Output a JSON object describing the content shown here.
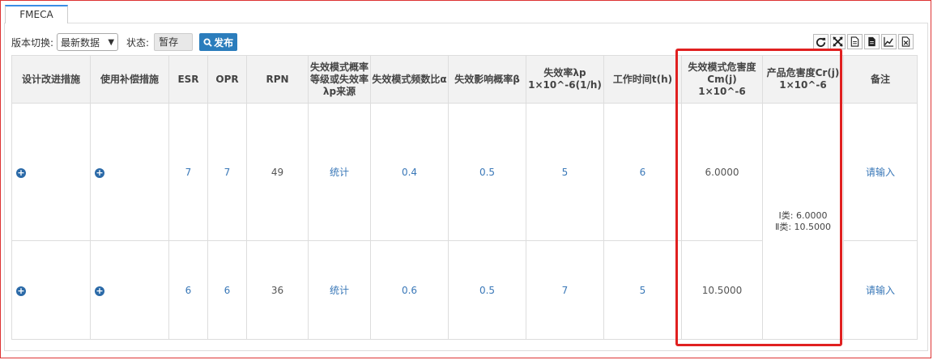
{
  "tab": {
    "label": "FMECA"
  },
  "toolbar": {
    "version_label": "版本切换:",
    "version_value": "最新数据",
    "status_label": "状态:",
    "status_value": "暂存",
    "publish_label": "发布"
  },
  "icons": [
    "refresh-icon",
    "fullscreen-icon",
    "document-icon",
    "file-icon",
    "line-chart-icon",
    "excel-icon"
  ],
  "headers": {
    "h0": "设计改进措施",
    "h1": "使用补偿措施",
    "h2": "ESR",
    "h3": "OPR",
    "h4": "RPN",
    "h5a": "失效模式概率",
    "h5b": "等级或失效率",
    "h5c": "λp来源",
    "h6": "失效模式频数比α",
    "h7": "失效影响概率β",
    "h8a": "失效率λp",
    "h8b": "1×10^-6(1/h)",
    "h9": "工作时间t(h)",
    "h10a": "失效模式危害度",
    "h10b": "Cm(j) 1×10^-6",
    "h11a": "产品危害度Cr(j)",
    "h11b": "1×10^-6",
    "h12": "备注"
  },
  "rows": [
    {
      "esr": "7",
      "opr": "7",
      "rpn": "49",
      "source": "统计",
      "alpha": "0.4",
      "beta": "0.5",
      "lambda": "5",
      "time": "6",
      "cm": "6.0000",
      "remark": "请输入"
    },
    {
      "esr": "6",
      "opr": "6",
      "rpn": "36",
      "source": "统计",
      "alpha": "0.6",
      "beta": "0.5",
      "lambda": "7",
      "time": "5",
      "cm": "10.5000",
      "remark": "请输入"
    }
  ],
  "cr": {
    "line1": "Ⅰ类: 6.0000",
    "line2": "Ⅱ类: 10.5000"
  },
  "colors": {
    "accent": "#2b7dbc",
    "highlight": "#e02020",
    "value_text": "#3a78b8"
  }
}
